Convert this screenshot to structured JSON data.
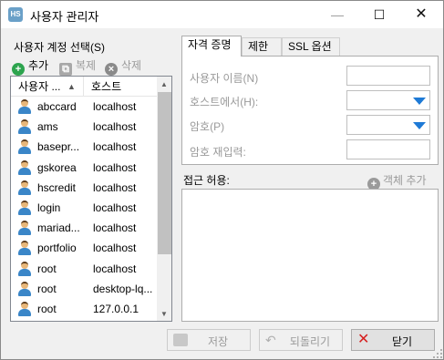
{
  "window": {
    "icon_text": "HS",
    "title": "사용자 관리자",
    "minimize": "—",
    "maximize": "☐",
    "close": "✕"
  },
  "left": {
    "label": "사용자 계정 선택(S)",
    "toolbar": {
      "add": "추가",
      "copy": "복제",
      "delete": "삭제"
    },
    "columns": {
      "user": "사용자 ...",
      "host": "호스트"
    },
    "users": [
      {
        "name": "abccard",
        "host": "localhost"
      },
      {
        "name": "ams",
        "host": "localhost"
      },
      {
        "name": "basepr...",
        "host": "localhost"
      },
      {
        "name": "gskorea",
        "host": "localhost"
      },
      {
        "name": "hscredit",
        "host": "localhost"
      },
      {
        "name": "login",
        "host": "localhost"
      },
      {
        "name": "mariad...",
        "host": "localhost"
      },
      {
        "name": "portfolio",
        "host": "localhost"
      },
      {
        "name": "root",
        "host": "localhost"
      },
      {
        "name": "root",
        "host": "desktop-lq..."
      },
      {
        "name": "root",
        "host": "127.0.0.1"
      }
    ]
  },
  "tabs": [
    {
      "label": "자격 증명",
      "active": true
    },
    {
      "label": "제한",
      "active": false
    },
    {
      "label": "SSL 옵션",
      "active": false
    }
  ],
  "credentials": {
    "username_label": "사용자 이름(N)",
    "username_value": "",
    "host_label": "호스트에서(H):",
    "host_value": "",
    "password_label": "암호(P)",
    "password_value": "",
    "repeat_label": "암호 재입력:",
    "repeat_value": ""
  },
  "access": {
    "label": "접근 허용:",
    "add_object": "객체 추가"
  },
  "buttons": {
    "save": "저장",
    "revert": "되돌리기",
    "close": "닫기"
  }
}
